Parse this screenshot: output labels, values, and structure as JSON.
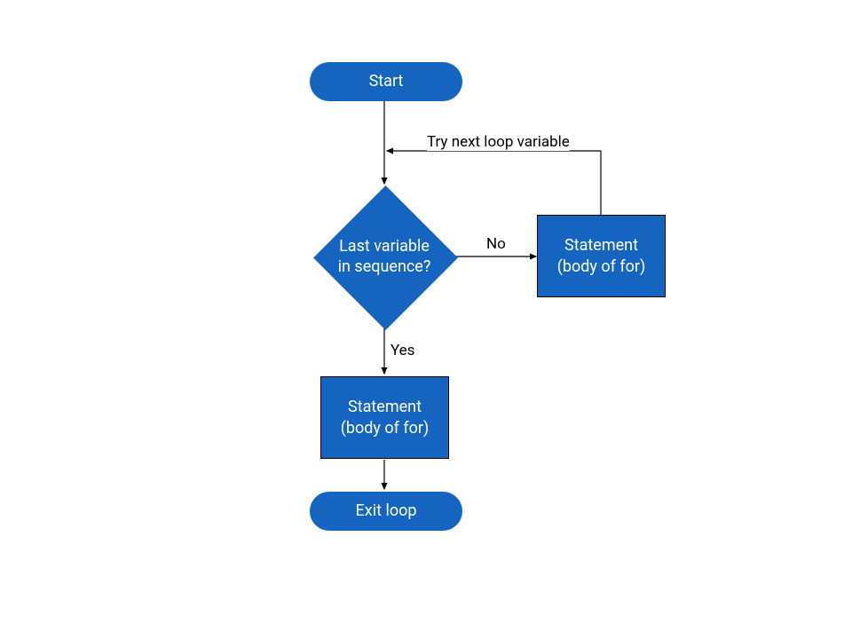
{
  "nodes": {
    "start": "Start",
    "decision": "Last variable in sequence?",
    "statement_right": "Statement (body of for)",
    "statement_below": "Statement (body of for)",
    "exit": "Exit loop"
  },
  "edges": {
    "no": "No",
    "yes": "Yes",
    "feedback": "Try next loop variable"
  },
  "colors": {
    "fill": "#1565c0",
    "text": "#ffffff",
    "line": "#000000"
  }
}
